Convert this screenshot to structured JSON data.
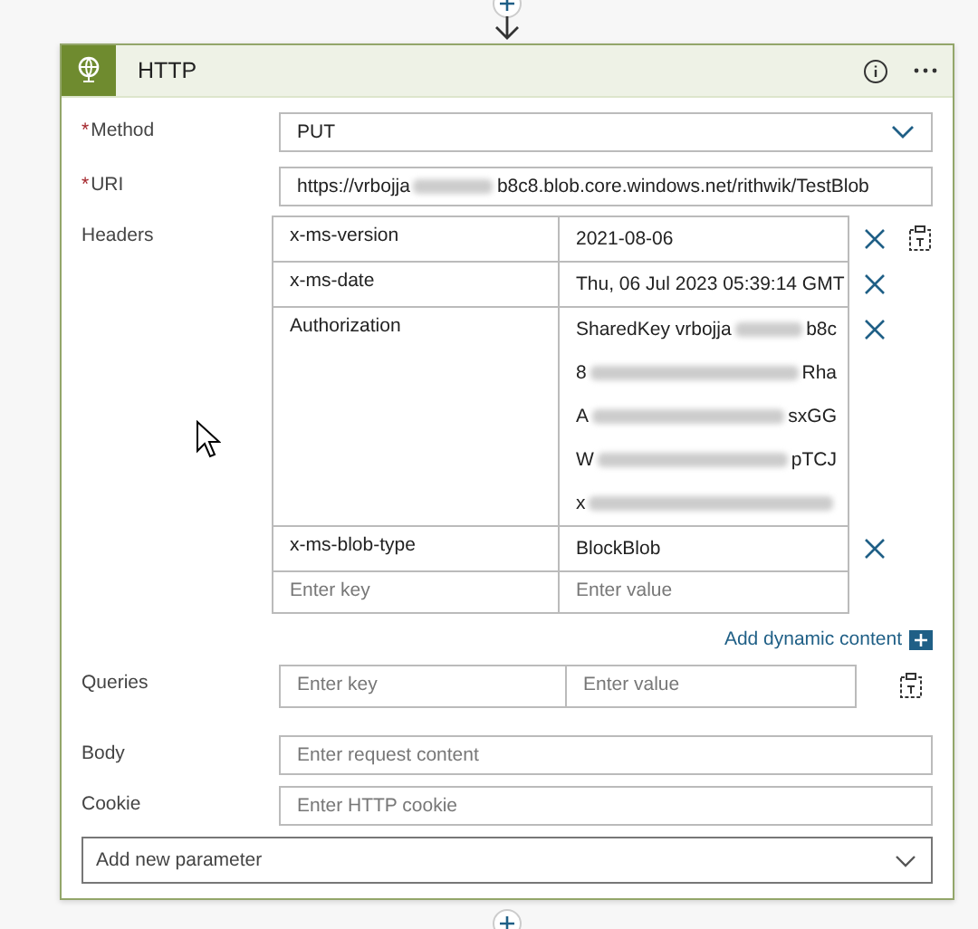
{
  "card": {
    "title": "HTTP"
  },
  "method": {
    "label": "Method",
    "required_mark": "*",
    "value": "PUT"
  },
  "uri": {
    "label": "URI",
    "required_mark": "*",
    "value": [
      {
        "kind": "text",
        "text": "https://vrbojja"
      },
      {
        "kind": "redacted"
      },
      {
        "kind": "text",
        "text": "b8c8.blob.core.windows.net/rithwik/TestBlob"
      }
    ]
  },
  "headers": {
    "label": "Headers",
    "rows": [
      {
        "key": "x-ms-version",
        "value": [
          [
            {
              "kind": "text",
              "text": "2021-08-06"
            }
          ]
        ]
      },
      {
        "key": "x-ms-date",
        "value": [
          [
            {
              "kind": "text",
              "text": "Thu, 06 Jul 2023 05:39:14 GMT"
            }
          ]
        ]
      },
      {
        "key": "Authorization",
        "value": [
          [
            {
              "kind": "text",
              "text": "SharedKey vrbojja"
            },
            {
              "kind": "redacted"
            },
            {
              "kind": "text",
              "text": "b8c"
            }
          ],
          [
            {
              "kind": "text",
              "text": "8"
            },
            {
              "kind": "redacted"
            },
            {
              "kind": "text",
              "text": "Rha"
            }
          ],
          [
            {
              "kind": "text",
              "text": "A"
            },
            {
              "kind": "redacted"
            },
            {
              "kind": "text",
              "text": "sxGG"
            }
          ],
          [
            {
              "kind": "text",
              "text": "W"
            },
            {
              "kind": "redacted"
            },
            {
              "kind": "text",
              "text": "pTCJ"
            }
          ],
          [
            {
              "kind": "text",
              "text": "x"
            },
            {
              "kind": "redacted"
            }
          ]
        ]
      },
      {
        "key": "x-ms-blob-type",
        "value": [
          [
            {
              "kind": "text",
              "text": "BlockBlob"
            }
          ]
        ]
      }
    ],
    "new_row": {
      "key_placeholder": "Enter key",
      "value_placeholder": "Enter value"
    }
  },
  "dynamic_content": {
    "label": "Add dynamic content"
  },
  "queries": {
    "label": "Queries",
    "key_placeholder": "Enter key",
    "value_placeholder": "Enter value"
  },
  "body": {
    "label": "Body",
    "placeholder": "Enter request content"
  },
  "cookie": {
    "label": "Cookie",
    "placeholder": "Enter HTTP cookie"
  },
  "add_parameter": {
    "placeholder": "Add new parameter"
  }
}
